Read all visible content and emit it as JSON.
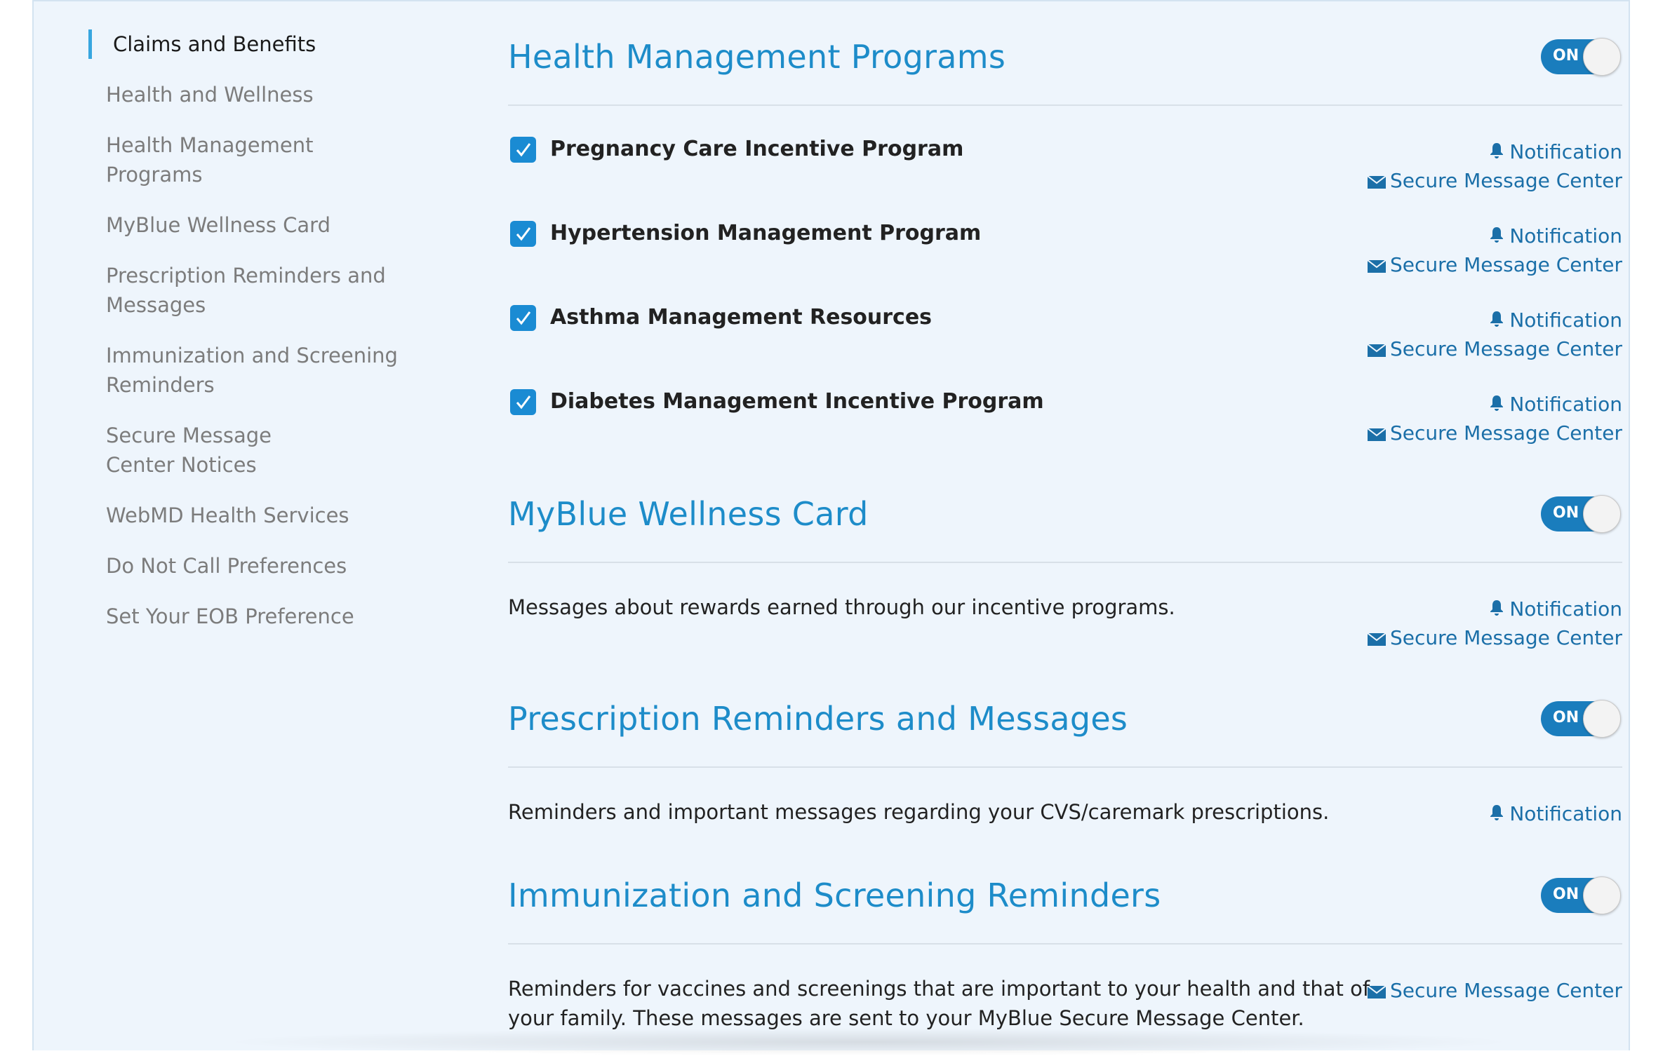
{
  "sidebar": {
    "items": [
      {
        "label": "Claims and Benefits",
        "active": true
      },
      {
        "label": "Health and Wellness"
      },
      {
        "label": "Health Management Programs"
      },
      {
        "label": "MyBlue Wellness Card"
      },
      {
        "label": "Prescription Reminders and Messages"
      },
      {
        "label": "Immunization and Screening Reminders"
      },
      {
        "label": "Secure Message Center Notices"
      },
      {
        "label": "WebMD Health Services"
      },
      {
        "label": "Do Not Call Preferences"
      },
      {
        "label": "Set Your EOB Preference"
      }
    ]
  },
  "links": {
    "notification": "Notification",
    "secure_message_center": "Secure Message Center"
  },
  "toggle_label": "ON",
  "sections": {
    "health_management": {
      "title": "Health Management Programs",
      "toggle_on": true,
      "programs": [
        {
          "label": "Pregnancy Care Incentive Program",
          "checked": true
        },
        {
          "label": "Hypertension Management Program",
          "checked": true
        },
        {
          "label": "Asthma Management Resources",
          "checked": true
        },
        {
          "label": "Diabetes Management Incentive Program",
          "checked": true
        }
      ]
    },
    "wellness_card": {
      "title": "MyBlue Wellness Card",
      "toggle_on": true,
      "description": "Messages about rewards earned through our incentive programs."
    },
    "prescription": {
      "title": "Prescription Reminders and Messages",
      "toggle_on": true,
      "description": "Reminders and important messages regarding your CVS/caremark prescriptions."
    },
    "immunization": {
      "title": "Immunization and Screening Reminders",
      "toggle_on": true,
      "description_line1": "Reminders for vaccines and screenings that are important to your health and that of",
      "description_line2": "your family. These messages are sent to your MyBlue Secure Message Center."
    }
  },
  "colors": {
    "accent": "#1d8cc9",
    "toggle_bg": "#1a7dbd",
    "link": "#1b6fa8",
    "panel_bg": "#eef5fc",
    "active_marker": "#38a6df"
  }
}
